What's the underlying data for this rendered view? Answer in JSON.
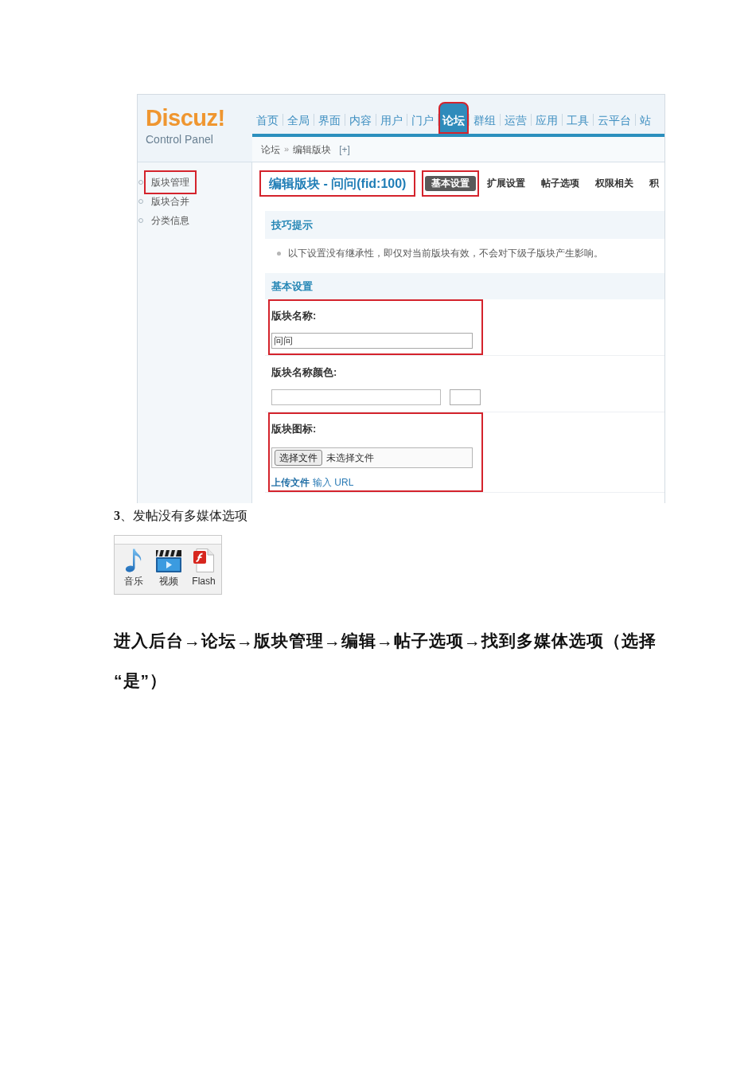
{
  "screenshot": {
    "logo": {
      "name": "Discuz!",
      "subtitle": "Control Panel"
    },
    "nav": [
      {
        "label": "首页",
        "selected": false,
        "highlighted": false
      },
      {
        "label": "全局",
        "selected": false,
        "highlighted": false
      },
      {
        "label": "界面",
        "selected": false,
        "highlighted": false
      },
      {
        "label": "内容",
        "selected": false,
        "highlighted": false
      },
      {
        "label": "用户",
        "selected": false,
        "highlighted": false
      },
      {
        "label": "门户",
        "selected": false,
        "highlighted": false
      },
      {
        "label": "论坛",
        "selected": true,
        "highlighted": true
      },
      {
        "label": "群组",
        "selected": false,
        "highlighted": false
      },
      {
        "label": "运营",
        "selected": false,
        "highlighted": false
      },
      {
        "label": "应用",
        "selected": false,
        "highlighted": false
      },
      {
        "label": "工具",
        "selected": false,
        "highlighted": false
      },
      {
        "label": "云平台",
        "selected": false,
        "highlighted": false
      },
      {
        "label": "站",
        "selected": false,
        "highlighted": false
      }
    ],
    "breadcrumb": {
      "items": [
        "论坛",
        "编辑版块"
      ],
      "separator": "»",
      "toggle": "[+]"
    },
    "sidebar": [
      {
        "label": "版块管理",
        "highlighted": true
      },
      {
        "label": "版块合并",
        "highlighted": false
      },
      {
        "label": "分类信息",
        "highlighted": false
      }
    ],
    "title": {
      "text": "编辑版块 - 问问(fid:100)",
      "highlighted": true
    },
    "tabs": [
      {
        "label": "基本设置",
        "selected": true,
        "highlighted": true
      },
      {
        "label": "扩展设置",
        "selected": false,
        "highlighted": false
      },
      {
        "label": "帖子选项",
        "selected": false,
        "highlighted": false
      },
      {
        "label": "权限相关",
        "selected": false,
        "highlighted": false
      },
      {
        "label": "积",
        "selected": false,
        "highlighted": false
      }
    ],
    "tips": {
      "title": "技巧提示",
      "items": [
        "以下设置没有继承性，即仅对当前版块有效，不会对下级子版块产生影响。"
      ]
    },
    "basic_settings": {
      "title": "基本设置",
      "fields": [
        {
          "kind": "text",
          "label": "版块名称:",
          "value": "问问",
          "highlighted": true
        },
        {
          "kind": "color",
          "label": "版块名称颜色:",
          "highlighted": false
        },
        {
          "kind": "file",
          "label": "版块图标:",
          "button": "选择文件",
          "status": "未选择文件",
          "modes": [
            {
              "label": "上传文件",
              "selected": true
            },
            {
              "label": "输入 URL",
              "selected": false
            }
          ],
          "highlighted": true
        }
      ]
    }
  },
  "heading": "**3**、发帖没有多媒体选项",
  "toolbar": [
    {
      "kind": "music",
      "label": "音乐"
    },
    {
      "kind": "video",
      "label": "视频"
    },
    {
      "kind": "flash",
      "label": "Flash"
    }
  ],
  "instruction": "进入后台→论坛→版块管理→编辑→帖子选项→找到多媒体选项（选择“是”）"
}
